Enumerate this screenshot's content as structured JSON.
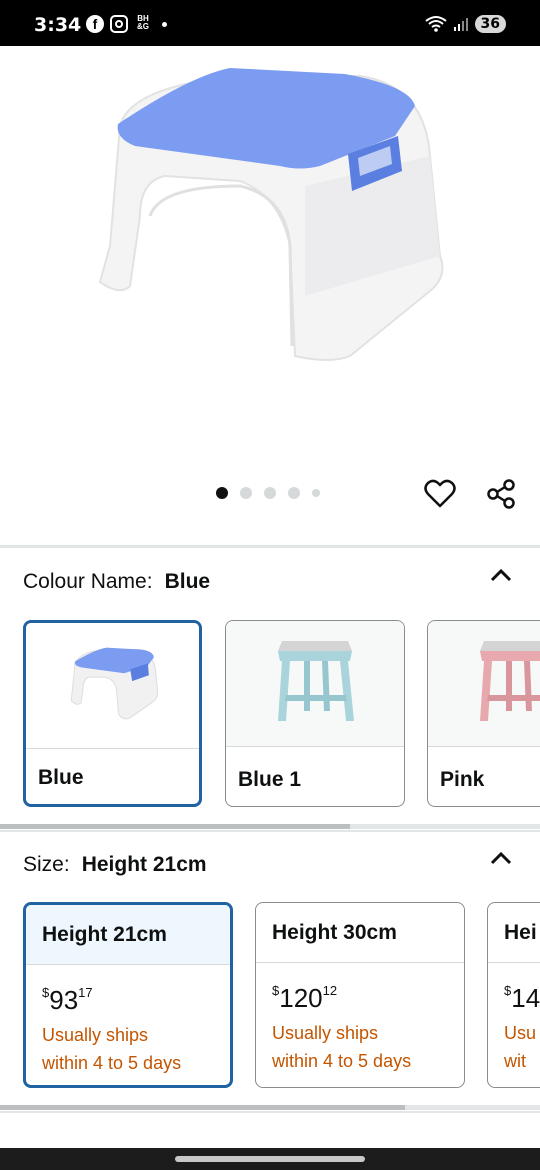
{
  "status_bar": {
    "time": "3:34",
    "left_icons": [
      "facebook-icon",
      "instagram-icon",
      "bh-app-icon",
      "notification-dot"
    ],
    "bh_text": "BH\n&G",
    "battery": "36"
  },
  "gallery": {
    "image_count": 5,
    "active_index": 0
  },
  "colour": {
    "label": "Colour Name:",
    "value": "Blue",
    "options": [
      {
        "label": "Blue",
        "selected": true
      },
      {
        "label": "Blue 1",
        "selected": false
      },
      {
        "label": "Pink",
        "selected": false
      }
    ]
  },
  "size": {
    "label": "Size:",
    "value": "Height 21cm",
    "options": [
      {
        "label": "Height 21cm",
        "currency": "$",
        "price_whole": "93",
        "price_fraction": "17",
        "ship_line1": "Usually ships",
        "ship_line2": "within 4 to 5 days",
        "selected": true
      },
      {
        "label": "Height 30cm",
        "currency": "$",
        "price_whole": "120",
        "price_fraction": "12",
        "ship_line1": "Usually ships",
        "ship_line2": "within 4 to 5 days",
        "selected": false
      },
      {
        "label": "Hei",
        "currency": "$",
        "price_whole": "14",
        "price_fraction": "",
        "ship_line1": "Usu",
        "ship_line2": "wit",
        "selected": false
      }
    ]
  },
  "colors": {
    "accent": "#2162a1",
    "ship_text": "#c45500",
    "stool_blue": "#7b9cf0",
    "stool_light_blue": "#a9d4dc",
    "stool_pink": "#e7a9ae"
  }
}
